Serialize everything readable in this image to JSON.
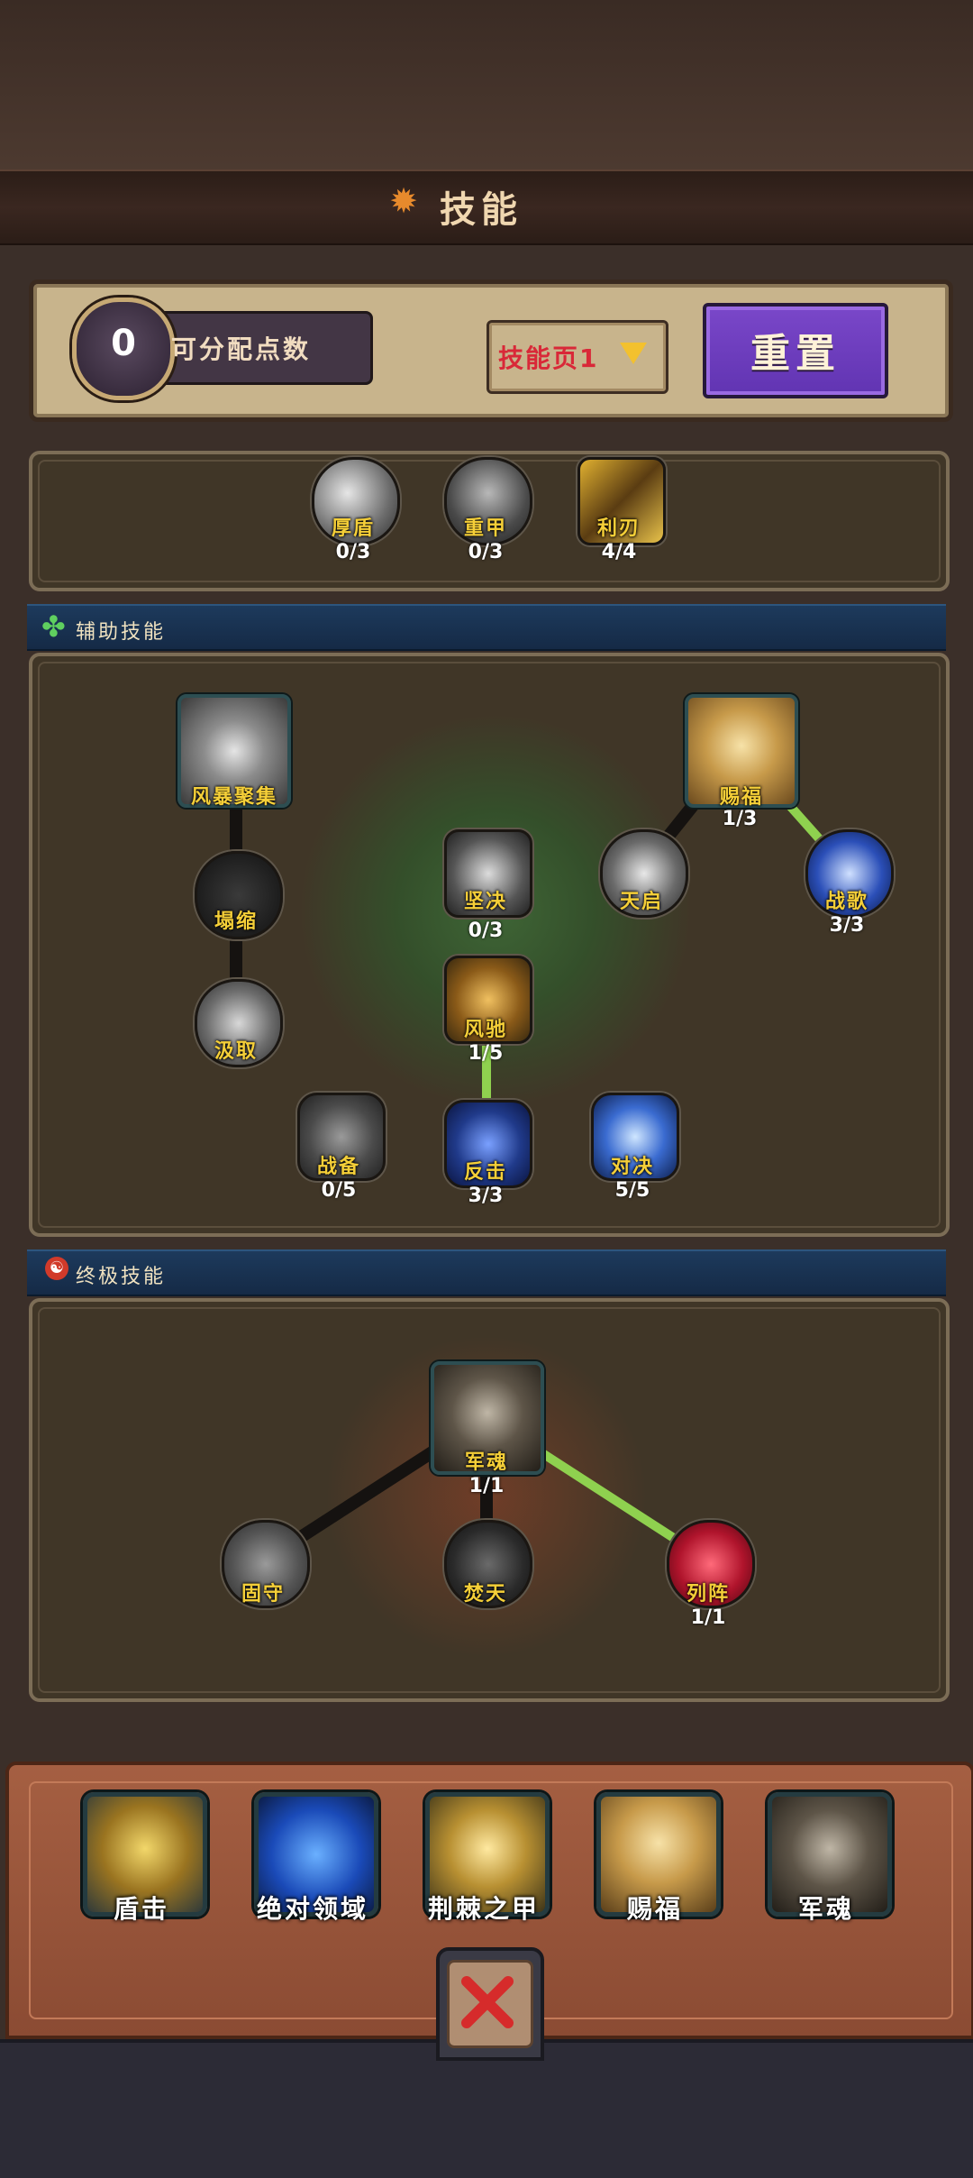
{
  "header": {
    "title": "技能"
  },
  "points": {
    "value": "0",
    "label": "可分配点数"
  },
  "page_selector": {
    "label": "技能页1"
  },
  "reset_button": {
    "label": "重置"
  },
  "top_skills": [
    {
      "name": "厚盾",
      "count": "0/3"
    },
    {
      "name": "重甲",
      "count": "0/3"
    },
    {
      "name": "利刃",
      "count": "4/4"
    }
  ],
  "support_section": {
    "title": "辅助技能",
    "skills": {
      "storm": {
        "name": "风暴聚集",
        "count": ""
      },
      "shrink": {
        "name": "塌缩",
        "count": ""
      },
      "absorb": {
        "name": "汲取",
        "count": ""
      },
      "resolve": {
        "name": "坚决",
        "count": "0/3"
      },
      "wind": {
        "name": "风驰",
        "count": "1/5"
      },
      "prep": {
        "name": "战备",
        "count": "0/5"
      },
      "counter": {
        "name": "反击",
        "count": "3/3"
      },
      "duel": {
        "name": "对决",
        "count": "5/5"
      },
      "bless": {
        "name": "赐福",
        "count": "1/3"
      },
      "revelation": {
        "name": "天启",
        "count": ""
      },
      "warsong": {
        "name": "战歌",
        "count": "3/3"
      }
    }
  },
  "ultimate_section": {
    "title": "终极技能",
    "skills": {
      "soul": {
        "name": "军魂",
        "count": "1/1"
      },
      "guard": {
        "name": "固守",
        "count": ""
      },
      "burn": {
        "name": "焚天",
        "count": ""
      },
      "formation": {
        "name": "列阵",
        "count": "1/1"
      }
    }
  },
  "equipped_slots": [
    {
      "name": "盾击"
    },
    {
      "name": "绝对领域"
    },
    {
      "name": "荆棘之甲"
    },
    {
      "name": "赐福"
    },
    {
      "name": "军魂"
    }
  ],
  "colors": {
    "active_line": "#8fd14f",
    "inactive_line": "#151210",
    "label": "#f5cf38",
    "reset_button": "#6b3bbd",
    "page_label": "#d92838"
  }
}
